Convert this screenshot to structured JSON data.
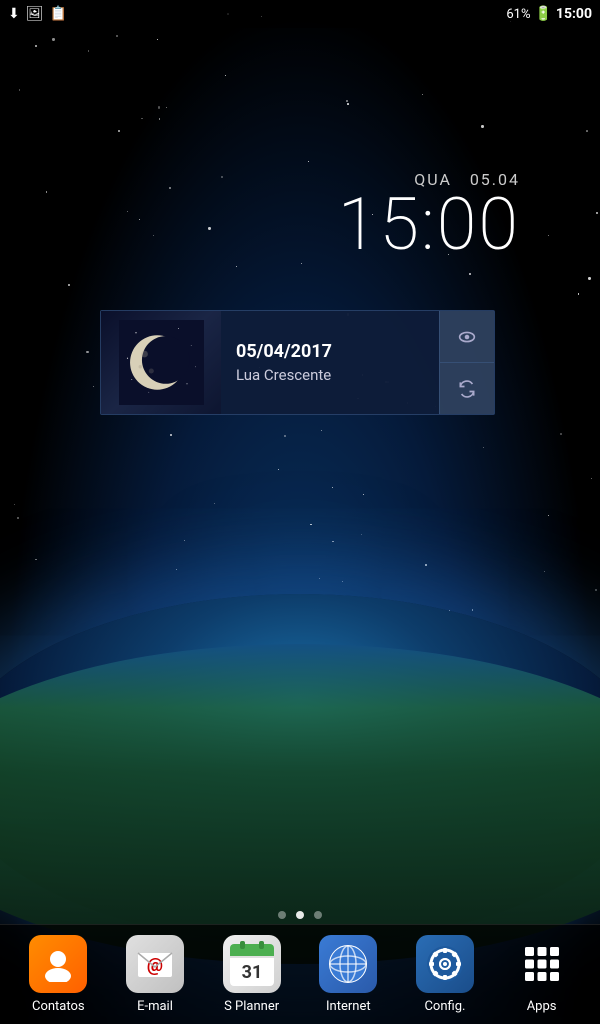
{
  "statusBar": {
    "batteryPercent": "61%",
    "batteryIcon": "🔋",
    "time": "15:00",
    "icons": [
      "⬇",
      "🖼",
      "📋"
    ]
  },
  "datetime": {
    "dayLabel": "QUA",
    "dateLabel": "05.04",
    "clock": "15:00"
  },
  "moonWidget": {
    "date": "05/04/2017",
    "phase": "Lua Crescente",
    "eyeBtn": "👁",
    "refreshBtn": "🔄"
  },
  "pageIndicators": [
    {
      "active": false
    },
    {
      "active": true
    },
    {
      "active": false
    }
  ],
  "dock": [
    {
      "id": "contatos",
      "label": "Contatos"
    },
    {
      "id": "email",
      "label": "E-mail"
    },
    {
      "id": "splanner",
      "label": "S Planner"
    },
    {
      "id": "internet",
      "label": "Internet"
    },
    {
      "id": "config",
      "label": "Config."
    },
    {
      "id": "apps",
      "label": "Apps"
    }
  ]
}
